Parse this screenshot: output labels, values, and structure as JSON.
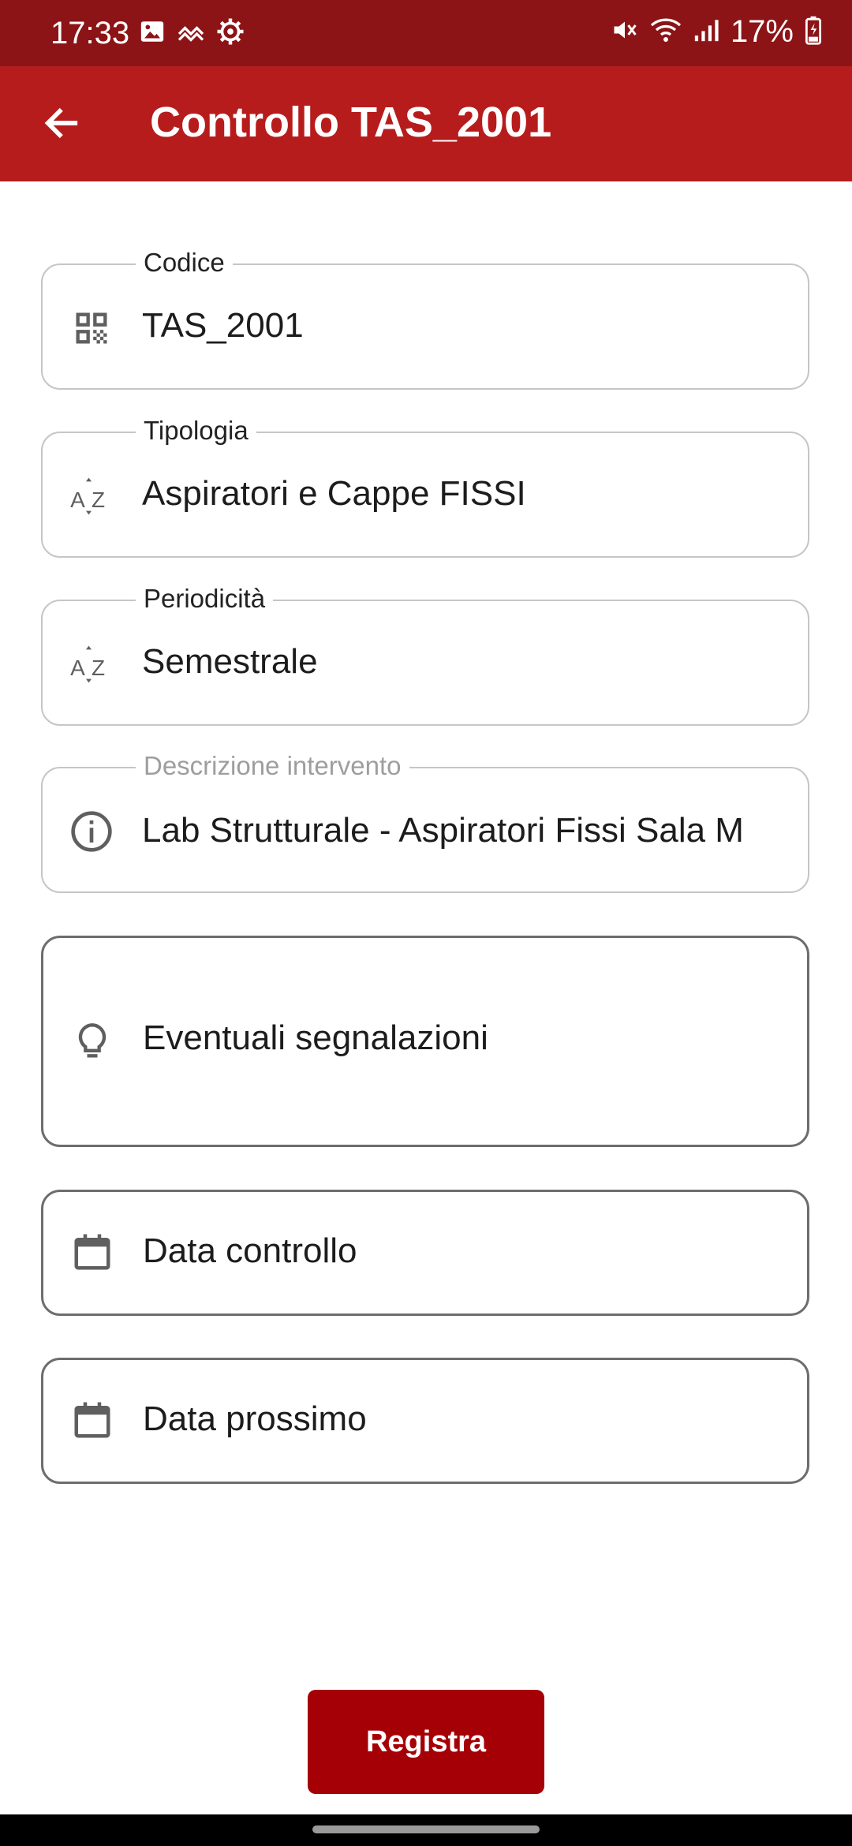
{
  "status_bar": {
    "time": "17:33",
    "battery": "17%",
    "icons": [
      "gallery-icon",
      "trend-icon",
      "settings-icon",
      "mute-icon",
      "wifi-icon",
      "signal-icon",
      "battery-icon"
    ]
  },
  "app_bar": {
    "title": "Controllo TAS_2001",
    "back_icon": "arrow-left-icon"
  },
  "form": {
    "codice": {
      "label": "Codice",
      "value": "TAS_2001",
      "icon": "qr-code-icon"
    },
    "tipologia": {
      "label": "Tipologia",
      "value": "Aspiratori e Cappe FISSI",
      "icon": "sort-az-icon"
    },
    "periodicita": {
      "label": "Periodicità",
      "value": "Semestrale",
      "icon": "sort-az-icon"
    },
    "descrizione": {
      "label": "Descrizione intervento",
      "value": "Lab Strutturale - Aspiratori Fissi Sala M",
      "icon": "info-icon"
    },
    "segnalazioni": {
      "placeholder": "Eventuali segnalazioni",
      "icon": "lightbulb-icon"
    },
    "data_controllo": {
      "placeholder": "Data controllo",
      "icon": "calendar-icon"
    },
    "data_prossimo": {
      "placeholder": "Data prossimo",
      "icon": "calendar-icon"
    }
  },
  "actions": {
    "register_label": "Registra"
  },
  "colors": {
    "status_bar": "#8c1416",
    "app_bar": "#b71c1c",
    "primary_button": "#a60007"
  }
}
